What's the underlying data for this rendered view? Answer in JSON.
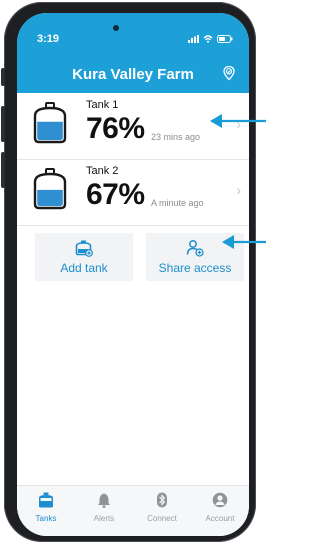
{
  "status_bar": {
    "time": "3:19"
  },
  "header": {
    "title": "Kura Valley Farm"
  },
  "tanks": [
    {
      "name": "Tank 1",
      "percent": "76%",
      "updated": "23 mins ago",
      "fill_fraction": 0.76
    },
    {
      "name": "Tank 2",
      "percent": "67%",
      "updated": "A minute ago",
      "fill_fraction": 0.67
    }
  ],
  "actions": {
    "add_tank": "Add tank",
    "share_access": "Share access"
  },
  "tabs": [
    {
      "label": "Tanks",
      "active": true
    },
    {
      "label": "Alerts",
      "active": false
    },
    {
      "label": "Connect",
      "active": false
    },
    {
      "label": "Account",
      "active": false
    }
  ],
  "colors": {
    "brand": "#1d9fd8",
    "accent_text": "#1d8fcf",
    "water": "#2f8fd0",
    "callout_arrow": "#1a9bd7"
  }
}
